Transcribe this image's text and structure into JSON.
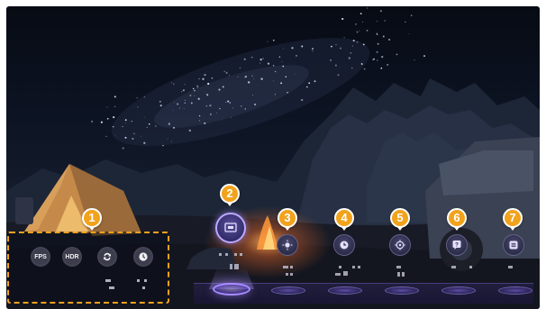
{
  "quick_settings": [
    {
      "label": "FPS",
      "icon": "fps-icon"
    },
    {
      "label": "HDR",
      "icon": "hdr-icon"
    },
    {
      "label": "",
      "icon": "sync-icon"
    },
    {
      "label": "",
      "icon": "clock-icon"
    }
  ],
  "callouts": [
    "1",
    "2",
    "3",
    "4",
    "5",
    "6",
    "7"
  ],
  "dock": {
    "active_index": 0,
    "items": [
      {
        "icon": "display-icon"
      },
      {
        "icon": "brightness-icon"
      },
      {
        "icon": "timer-icon"
      },
      {
        "icon": "crosshair-icon"
      },
      {
        "icon": "help-icon"
      },
      {
        "icon": "menu-icon"
      }
    ]
  },
  "colors": {
    "callout": "#f2a21b",
    "panel_border": "#f2a21b",
    "dock_glow": "#a98cff"
  }
}
